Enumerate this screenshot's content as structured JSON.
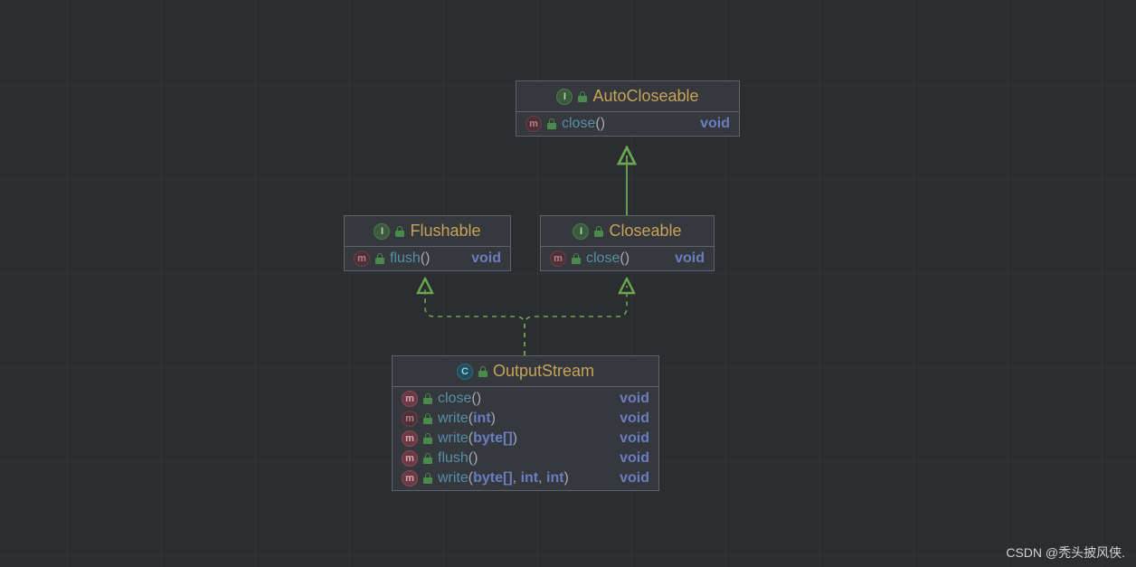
{
  "colors": {
    "title": "#c7a35a",
    "method": "#568faa",
    "keyword": "#6b7dc1",
    "bg": "#2b2d30"
  },
  "nodes": {
    "autocloseable": {
      "kind": "I",
      "title": "AutoCloseable",
      "methods": [
        {
          "badge": "m_abstract",
          "name": "close",
          "params": [],
          "return": "void"
        }
      ]
    },
    "flushable": {
      "kind": "I",
      "title": "Flushable",
      "methods": [
        {
          "badge": "m_abstract",
          "name": "flush",
          "params": [],
          "return": "void"
        }
      ]
    },
    "closeable": {
      "kind": "I",
      "title": "Closeable",
      "methods": [
        {
          "badge": "m_abstract",
          "name": "close",
          "params": [],
          "return": "void"
        }
      ]
    },
    "outputstream": {
      "kind": "C",
      "title": "OutputStream",
      "methods": [
        {
          "badge": "m",
          "name": "close",
          "params": [],
          "return": "void"
        },
        {
          "badge": "m_abstract",
          "name": "write",
          "params": [
            "int"
          ],
          "return": "void"
        },
        {
          "badge": "m",
          "name": "write",
          "params": [
            "byte[]"
          ],
          "return": "void"
        },
        {
          "badge": "m",
          "name": "flush",
          "params": [],
          "return": "void"
        },
        {
          "badge": "m",
          "name": "write",
          "params": [
            "byte[]",
            "int",
            "int"
          ],
          "return": "void"
        }
      ]
    }
  },
  "edges": [
    {
      "from": "closeable",
      "to": "autocloseable",
      "style": "solid"
    },
    {
      "from": "outputstream",
      "to": "flushable",
      "style": "dashed"
    },
    {
      "from": "outputstream",
      "to": "closeable",
      "style": "dashed"
    }
  ],
  "watermark": "CSDN @秃头披风侠."
}
